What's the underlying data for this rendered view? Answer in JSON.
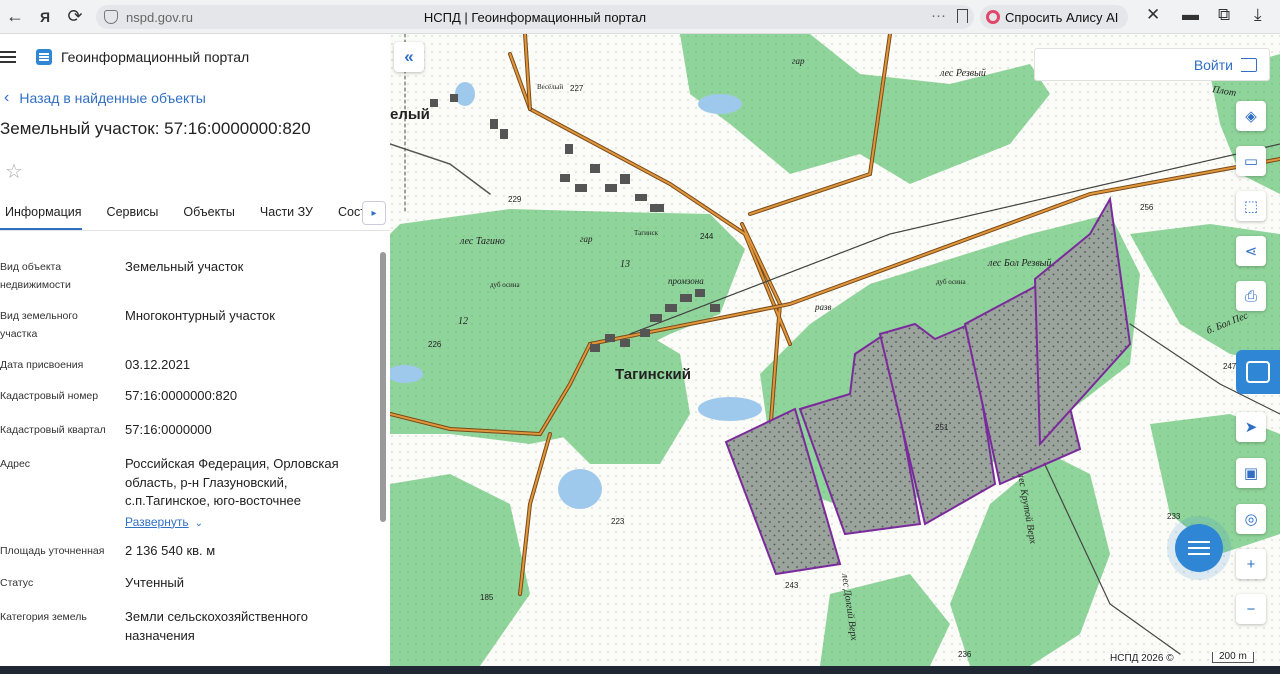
{
  "browser": {
    "back_icon": "arrow-left-icon",
    "yandex_icon": "yandex-icon",
    "reload_icon": "reload-icon",
    "host": "nspd.gov.ru",
    "page_title": "НСПД | Геоинформационный портал",
    "menu_dots": "···",
    "alice_label": "Спросить Алису AI"
  },
  "header": {
    "portal_title": "Геоинформационный портал"
  },
  "back_link": "Назад в найденные объекты",
  "object_title": "Земельный участок: 57:16:0000000:820",
  "tabs": [
    "Информация",
    "Сервисы",
    "Объекты",
    "Части ЗУ",
    "Состав"
  ],
  "properties": [
    {
      "label": "Вид объекта недвижимости",
      "value": "Земельный участок"
    },
    {
      "label": "Вид земельного участка",
      "value": "Многоконтурный участок"
    },
    {
      "label": "Дата присвоения",
      "value": "03.12.2021"
    },
    {
      "label": "Кадастровый номер",
      "value": "57:16:0000000:820"
    },
    {
      "label": "Кадастровый квартал",
      "value": "57:16:0000000"
    },
    {
      "label": "Адрес",
      "value": "Российская Федерация, Орловская область, р-н Глазуновский, с.п.Тагинское, юго-восточнее"
    },
    {
      "label": "Площадь уточненная",
      "value": "2 136 540 кв. м"
    },
    {
      "label": "Статус",
      "value": "Учтенный"
    },
    {
      "label": "Категория земель",
      "value": "Земли сельскохозяйственного назначения"
    }
  ],
  "expand_label": "Развернуть",
  "map": {
    "login_label": "Войти",
    "attribution": "НСПД 2026 ©",
    "scale_label": "200 m",
    "labels": {
      "village": "Тагинский",
      "village_left": "елый",
      "forest_tagino": "лес Тагино",
      "forest_rezvy": "лес Резвый",
      "forest_bol_rezvy": "лес Бол Резвый",
      "forest_krutoy": "лес Крутой Верх",
      "forest_dolgy": "лес Долгий Верх",
      "ves": "Весёлый",
      "gar1": "гар",
      "gar2": "гар",
      "razv": "разв",
      "promzona": "промзона",
      "taginsk_small": "Тагинск",
      "oak1": "дуб осина",
      "oak2": "дуб осина",
      "num_12": "12",
      "num_13": "13",
      "bol_pes": "б. Бол Пес",
      "plot": "Плот",
      "h227": "227",
      "h229": "229",
      "h226": "226",
      "h244": "244",
      "h256": "256",
      "h247": "247",
      "h251": "251",
      "h223": "223",
      "h243": "243",
      "h233": "233",
      "h236": "236",
      "h185": "185"
    }
  }
}
